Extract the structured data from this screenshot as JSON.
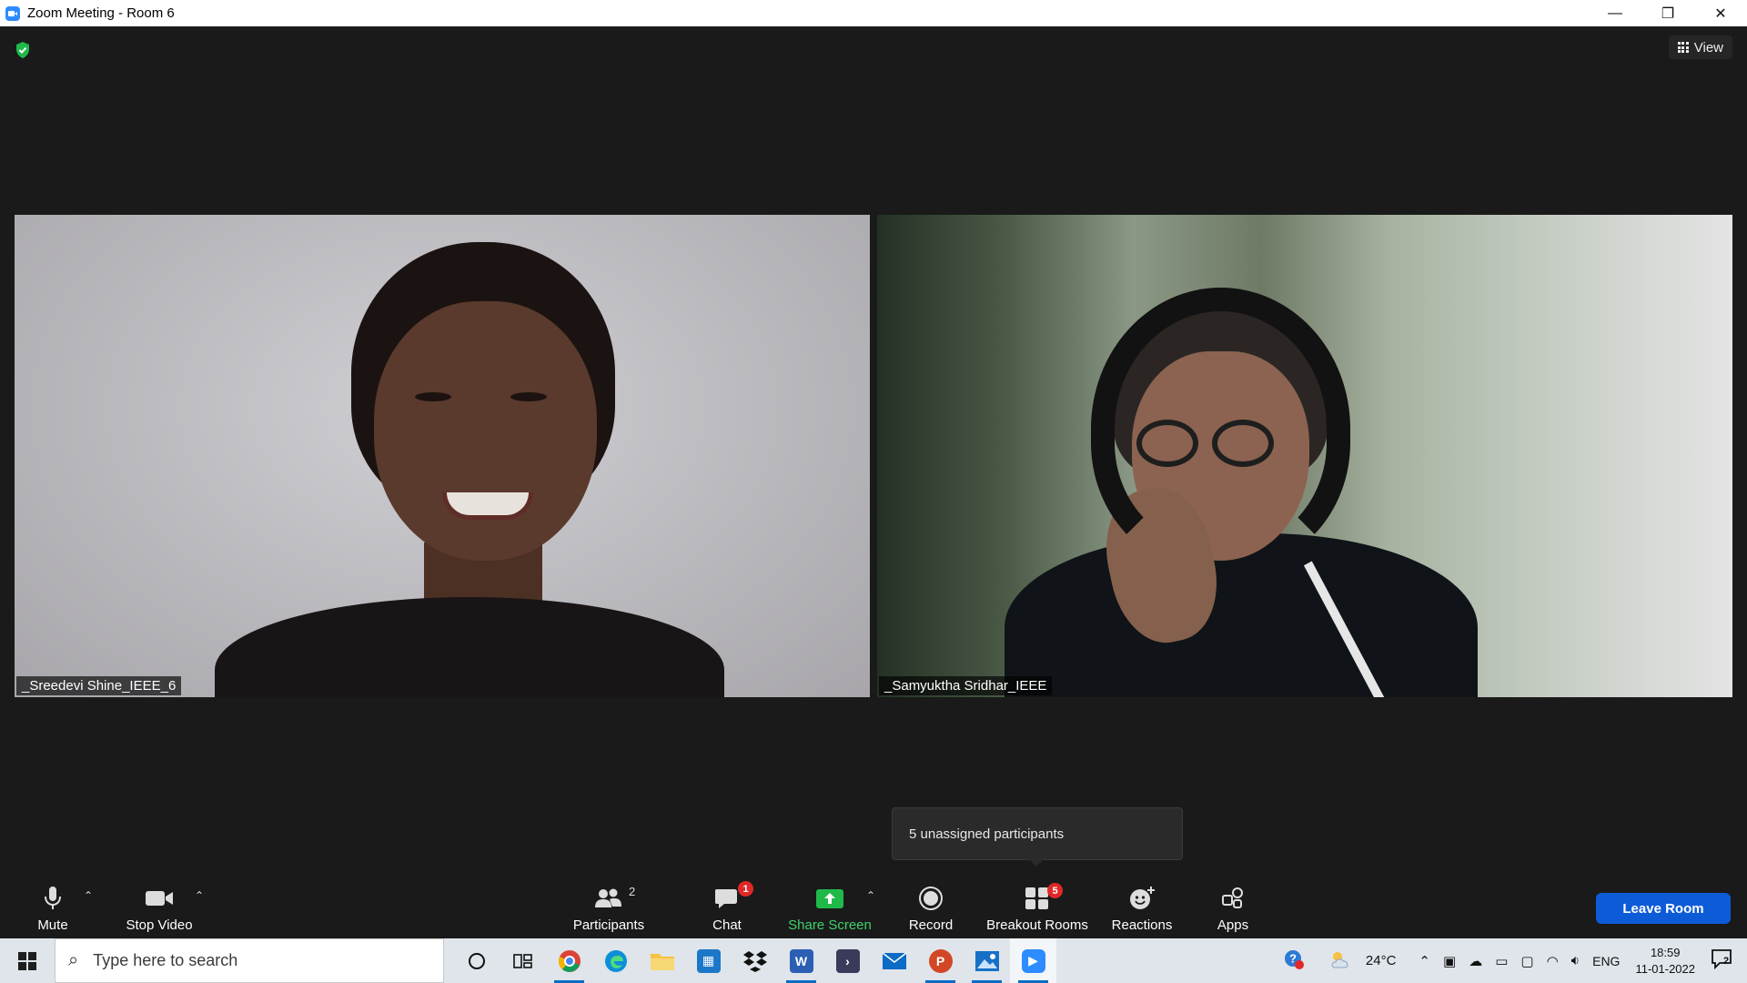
{
  "window": {
    "title": "Zoom Meeting - Room 6",
    "controls": {
      "minimize": "—",
      "restore": "❐",
      "close": "✕"
    }
  },
  "meeting": {
    "view_label": "View",
    "participants": [
      {
        "name": "_Sreedevi Shine_IEEE_6"
      },
      {
        "name": "_Samyuktha Sridhar_IEEE"
      }
    ],
    "tooltip": "5 unassigned participants"
  },
  "toolbar": {
    "mute": "Mute",
    "stop_video": "Stop Video",
    "participants": "Participants",
    "participants_count": "2",
    "chat": "Chat",
    "chat_badge": "1",
    "share_screen": "Share Screen",
    "record": "Record",
    "breakout_rooms": "Breakout Rooms",
    "breakout_badge": "5",
    "reactions": "Reactions",
    "apps": "Apps",
    "leave": "Leave Room"
  },
  "taskbar": {
    "search_placeholder": "Type here to search",
    "apps": [
      "cortana",
      "task-view",
      "chrome",
      "edge",
      "file-explorer",
      "store",
      "dropbox",
      "word",
      "visual-studio",
      "mail",
      "powerpoint",
      "photos",
      "zoom"
    ],
    "tray": {
      "temperature": "24°C",
      "language": "ENG",
      "time": "18:59",
      "date": "11-01-2022",
      "notifications": "2"
    }
  },
  "colors": {
    "accent": "#0e5bd8",
    "share_green": "#3fd36b",
    "badge_red": "#e02828",
    "background": "#1a1a1a"
  }
}
